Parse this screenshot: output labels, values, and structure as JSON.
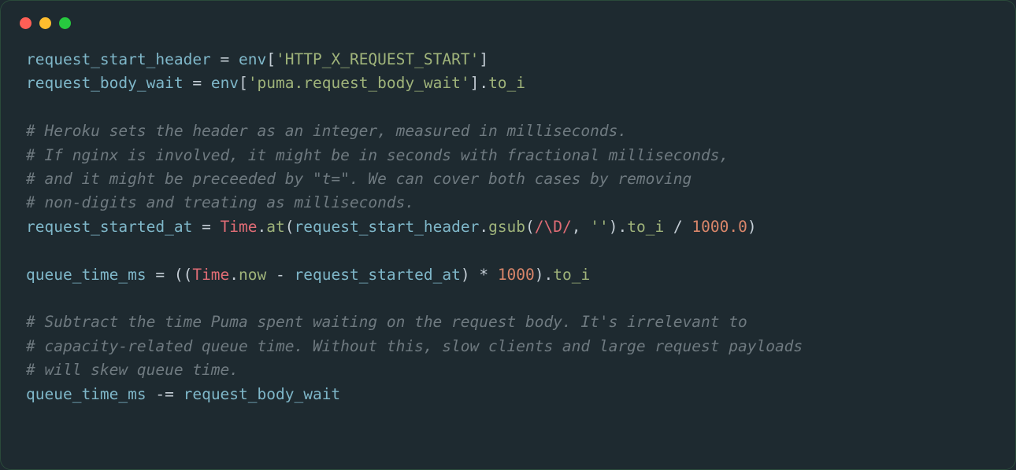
{
  "titlebar": {
    "dots": [
      "red",
      "yellow",
      "green"
    ]
  },
  "code": {
    "l01": {
      "var1": "request_start_header",
      "eq": " = ",
      "env": "env",
      "br_o": "[",
      "str": "'HTTP_X_REQUEST_START'",
      "br_c": "]"
    },
    "l02": {
      "var1": "request_body_wait",
      "eq": " = ",
      "env": "env",
      "br_o": "[",
      "str": "'puma.request_body_wait'",
      "br_c": "].",
      "meth": "to_i"
    },
    "l03": "",
    "l04": "# Heroku sets the header as an integer, measured in milliseconds.",
    "l05": "# If nginx is involved, it might be in seconds with fractional milliseconds,",
    "l06": "# and it might be preceeded by \"t=\". We can cover both cases by removing",
    "l07": "# non-digits and treating as milliseconds.",
    "l08": {
      "var1": "request_started_at",
      "eq": " = ",
      "time": "Time",
      "dot1": ".",
      "at": "at",
      "p_o": "(",
      "arg": "request_start_header",
      "dot2": ".",
      "gsub": "gsub",
      "p2_o": "(",
      "regex": "/\\D/",
      "comma": ", ",
      "empt": "''",
      "p2_c": ").",
      "toi": "to_i",
      "div": " / ",
      "num": "1000.0",
      "p_c": ")"
    },
    "l09": "",
    "l10": {
      "var1": "queue_time_ms",
      "eq": " = ((",
      "time": "Time",
      "dot1": ".",
      "now": "now",
      "minus": " - ",
      "rsa": "request_started_at",
      "p_c": ") * ",
      "num": "1000",
      "p_c2": ").",
      "toi": "to_i"
    },
    "l11": "",
    "l12": "# Subtract the time Puma spent waiting on the request body. It's irrelevant to",
    "l13": "# capacity-related queue time. Without this, slow clients and large request payloads",
    "l14": "# will skew queue time.",
    "l15": {
      "var1": "queue_time_ms",
      "op": " -= ",
      "var2": "request_body_wait"
    }
  }
}
